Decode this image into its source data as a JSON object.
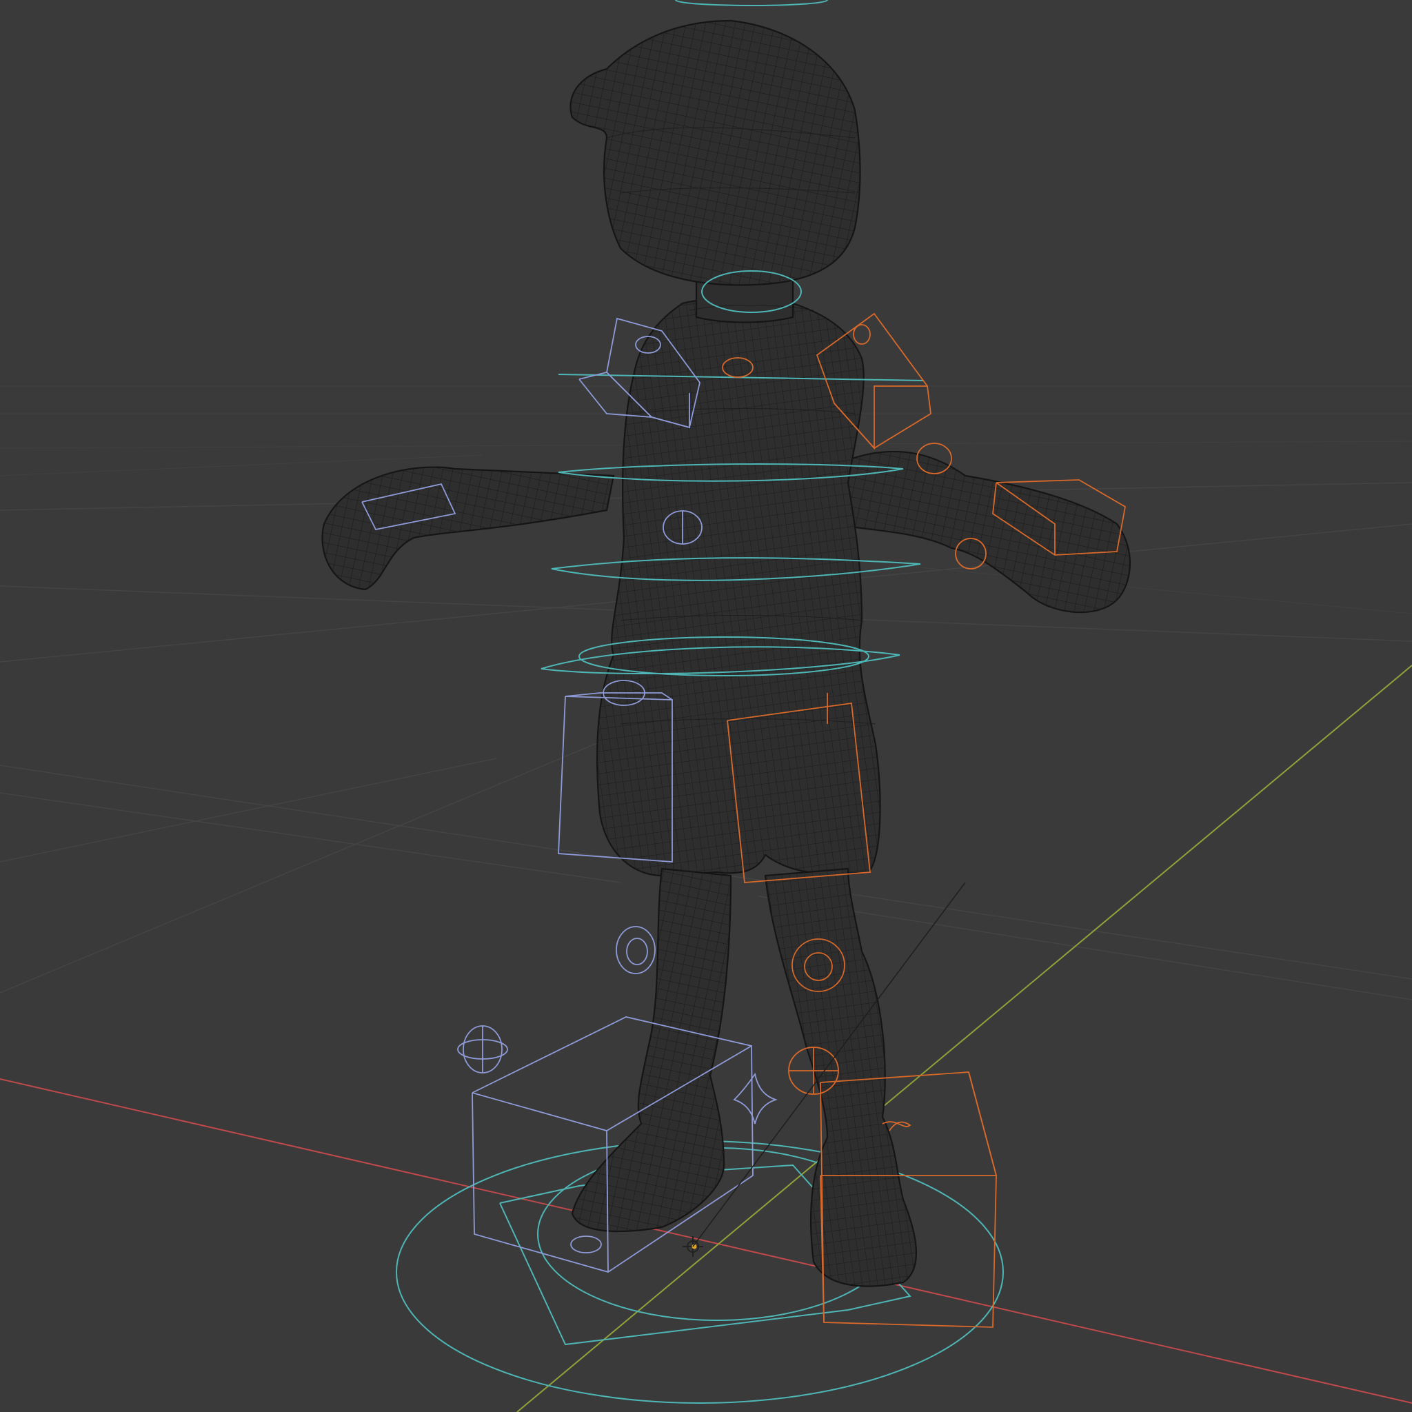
{
  "viewport": {
    "background": "#3a3a3a",
    "shading_mode": "wireframe",
    "grid_color": "#444444"
  },
  "axes": {
    "x_axis_color": "#c0494b",
    "y_axis_color": "#8fa33a"
  },
  "scene": {
    "object": "character-mesh",
    "rig": {
      "left_side_color": "#8f9bd8",
      "right_side_color": "#d8692a",
      "center_color": "#4fb6b6"
    },
    "origin_marker_color": "#e0a020"
  }
}
